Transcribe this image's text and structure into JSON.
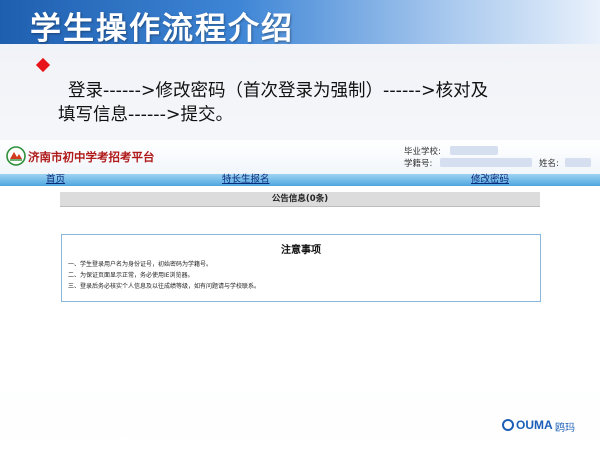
{
  "slide": {
    "title": "学生操作流程介绍",
    "bullet_line1": "登录------>修改密码（首次登录为强制）------>核对及",
    "bullet_line2": "填写信息------>提交。"
  },
  "portal": {
    "name": "济南市初中学考招考平台",
    "school_label": "毕业学校:",
    "student_id_label": "学籍号:",
    "name_label": "姓名:",
    "nav": {
      "home": "首页",
      "specialty": "特长生报名",
      "change_password": "修改密码"
    },
    "notice_header": "公告信息(0条)",
    "notes": {
      "title": "注意事项",
      "items": [
        "一、学生登录用户名为身份证号，初始密码为学籍号。",
        "二、为保证页面显示正常，务必使用IE浏览器。",
        "三、登录后务必核实个人信息及以往成绩等级，如有问题请与学校联系。"
      ]
    }
  },
  "brand": {
    "logo_text": "OUMA",
    "logo_cn": "鸥玛"
  },
  "colors": {
    "title_bar": "#1f5fb0",
    "bullet": "#e8141b",
    "nav_bar": "#4ea6e0",
    "portal_name": "#b01a1a",
    "brand": "#1b5fb7"
  }
}
